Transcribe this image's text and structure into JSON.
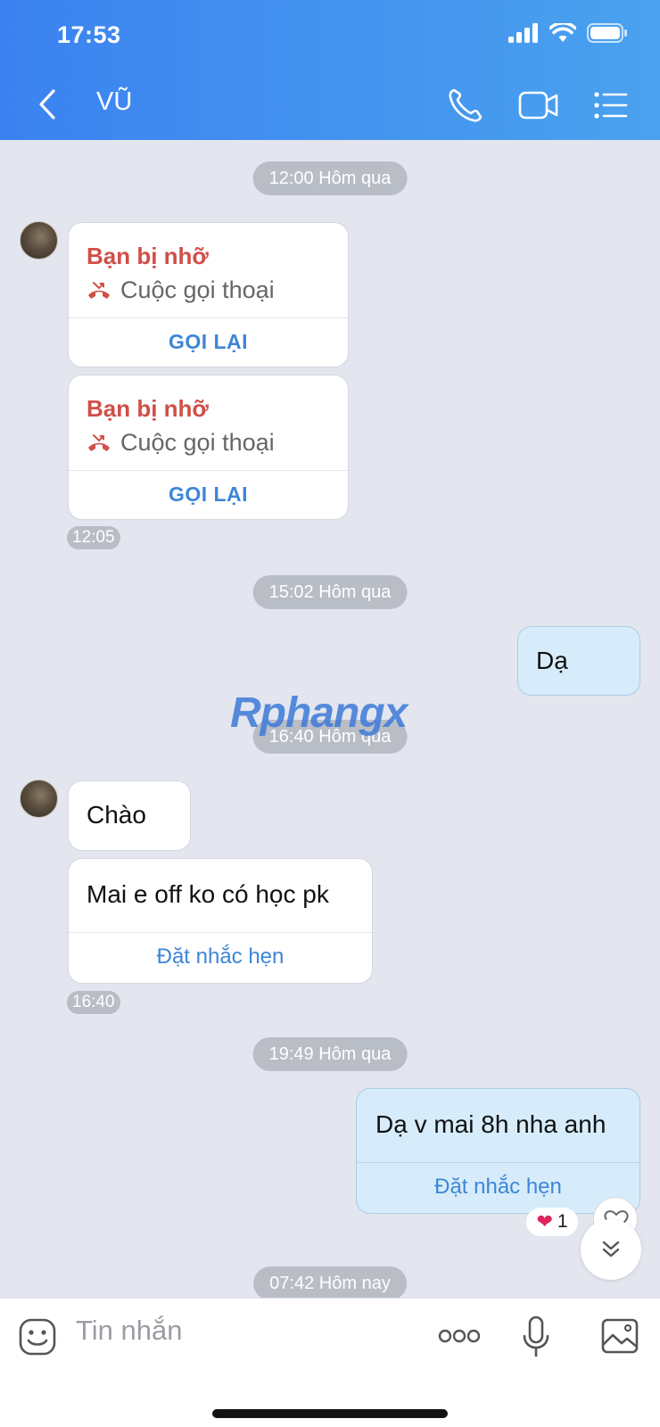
{
  "status_bar": {
    "time": "17:53"
  },
  "header": {
    "contact_name": "VŨ"
  },
  "separators": {
    "s1": "12:00 Hôm qua",
    "s2": "15:02 Hôm qua",
    "s3": "16:40 Hôm qua",
    "s4": "19:49 Hôm qua",
    "s5": "07:42 Hôm nay"
  },
  "missed_calls": [
    {
      "title": "Bạn bị nhỡ",
      "subtitle": "Cuộc gọi thoại",
      "action": "GỌI LẠI"
    },
    {
      "title": "Bạn bị nhỡ",
      "subtitle": "Cuộc gọi thoại",
      "action": "GỌI LẠI"
    }
  ],
  "messages": {
    "time_1205": "12:05",
    "sent_da": "Dạ",
    "recv_chao": "Chào",
    "recv_mai": "Mai e off ko có học pk",
    "recv_mai_action": "Đặt nhắc hẹn",
    "time_1640": "16:40",
    "sent_mai8h": "Dạ v mai 8h nha anh",
    "sent_mai8h_action": "Đặt nhắc hẹn",
    "reaction_count": "1"
  },
  "watermark": "Rphangx",
  "input": {
    "placeholder": "Tin nhắn"
  },
  "colors": {
    "header_start": "#3b82f0",
    "header_end": "#4aa2ee",
    "accent": "#3d86d6",
    "missed": "#d04f47",
    "sent_bubble": "#d6ecfb"
  }
}
